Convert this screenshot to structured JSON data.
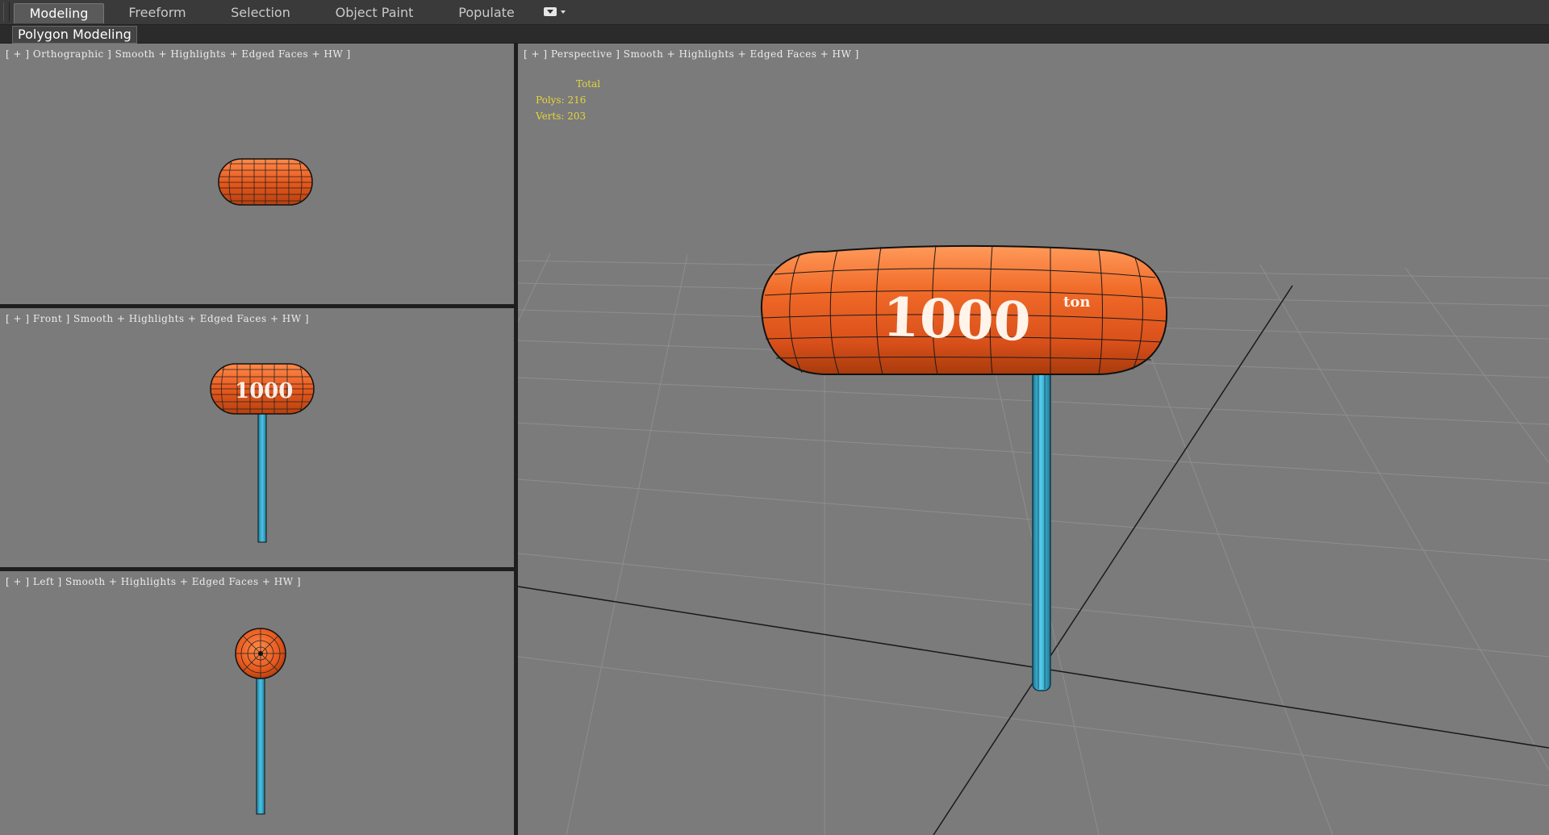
{
  "ribbon": {
    "tabs": [
      "Modeling",
      "Freeform",
      "Selection",
      "Object Paint",
      "Populate"
    ],
    "active_tab": "Modeling",
    "panel_label": "Polygon Modeling"
  },
  "viewports": {
    "top": {
      "label": "[ + ] Orthographic ] Smooth + Highlights + Edged Faces + HW ]"
    },
    "front": {
      "label": "[ + ] Front ] Smooth + Highlights + Edged Faces + HW ]"
    },
    "left": {
      "label": "[ + ] Left ] Smooth + Highlights + Edged Faces + HW ]"
    },
    "perspective": {
      "label": "[ + ] Perspective ] Smooth + Highlights + Edged Faces + HW ]",
      "stats": {
        "header": "Total",
        "polys_label": "Polys:",
        "polys": "216",
        "verts_label": "Verts:",
        "verts": "203"
      }
    }
  },
  "model": {
    "head_text": "1000",
    "head_superscript": "ton",
    "head_color": "#e85a1e",
    "handle_color": "#2aa9d0"
  },
  "colors": {
    "viewport_bg": "#7b7b7b",
    "stats_text": "#e6d43a",
    "ribbon_bg": "#3a3a3a"
  }
}
